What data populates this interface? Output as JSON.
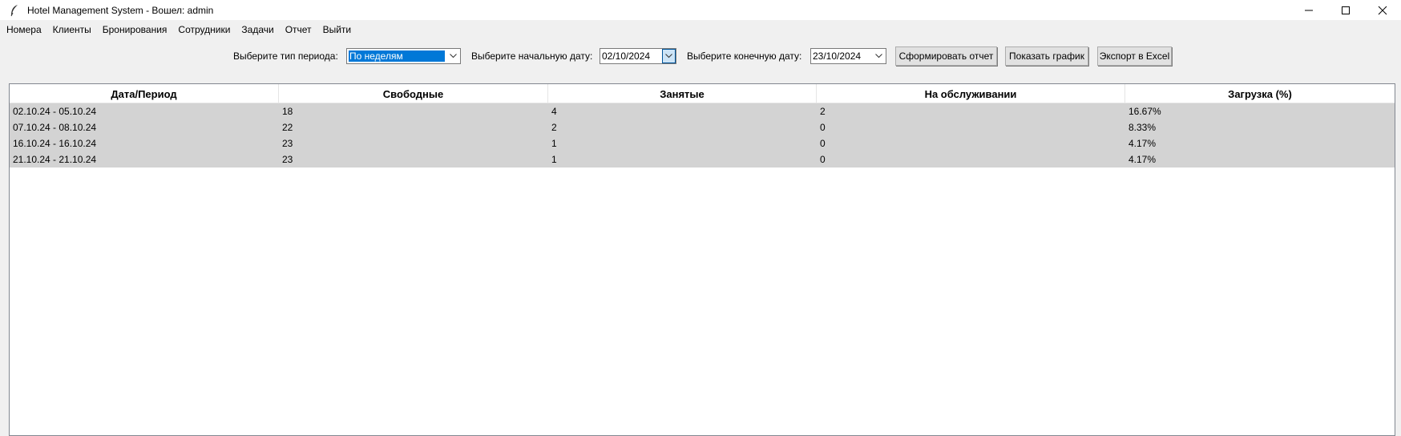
{
  "window": {
    "title": "Hotel Management System - Вошел: admin",
    "icon": "feather-icon",
    "controls": [
      "minimize-icon",
      "maximize-icon",
      "close-icon"
    ]
  },
  "menu": {
    "items": [
      "Номера",
      "Клиенты",
      "Бронирования",
      "Сотрудники",
      "Задачи",
      "Отчет",
      "Выйти"
    ]
  },
  "toolbar": {
    "period_type_label": "Выберите тип периода:",
    "period_type_value": "По неделям",
    "start_date_label": "Выберите начальную дату:",
    "start_date_value": "02/10/2024",
    "end_date_label": "Выберите конечную дату:",
    "end_date_value": "23/10/2024",
    "generate_report_label": "Сформировать отчет",
    "show_chart_label": "Показать график",
    "export_excel_label": "Экспорт в Excel"
  },
  "table": {
    "columns": [
      "Дата/Период",
      "Свободные",
      "Занятые",
      "На обслуживании",
      "Загрузка (%)"
    ],
    "rows": [
      [
        "02.10.24 - 05.10.24",
        "18",
        "4",
        "2",
        "16.67%"
      ],
      [
        "07.10.24 - 08.10.24",
        "22",
        "2",
        "0",
        "8.33%"
      ],
      [
        "16.10.24 - 16.10.24",
        "23",
        "1",
        "0",
        "4.17%"
      ],
      [
        "21.10.24 - 21.10.24",
        "23",
        "1",
        "0",
        "4.17%"
      ]
    ]
  },
  "colors": {
    "selection": "#0078d7",
    "row_background": "#d3d3d3",
    "window_background": "#f0f0f0"
  }
}
